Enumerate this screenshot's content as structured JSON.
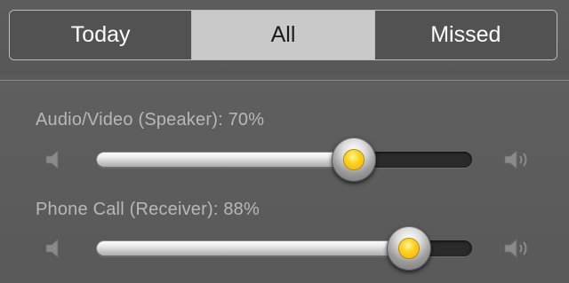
{
  "tabs": [
    {
      "label": "Today",
      "selected": false
    },
    {
      "label": "All",
      "selected": true
    },
    {
      "label": "Missed",
      "selected": false
    }
  ],
  "volume_controls": [
    {
      "label": "Audio/Video (Speaker): 70%",
      "value_percent": 70,
      "min_icon": "speaker-low-icon",
      "max_icon": "speaker-high-icon"
    },
    {
      "label": "Phone Call (Receiver): 88%",
      "value_percent": 88,
      "min_icon": "speaker-low-icon",
      "max_icon": "speaker-high-icon"
    }
  ],
  "colors": {
    "background": "#5a5a5a",
    "selected_segment": "#c9c9c9",
    "thumb_center": "#ffd21f",
    "label_text": "#b8b8b8"
  }
}
